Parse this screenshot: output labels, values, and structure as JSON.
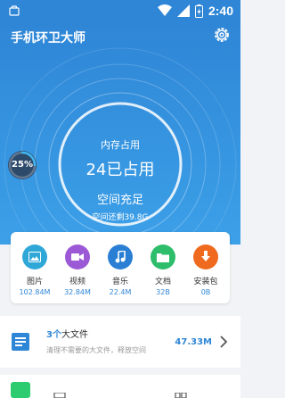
{
  "status_bar": {
    "time": "2:40"
  },
  "header": {
    "title": "手机环卫大师"
  },
  "memory": {
    "usage_percent_label": "25%",
    "usage_fraction": 0.25,
    "title": "内存占用",
    "value": "24已占用",
    "status": "空间充足",
    "free": "空间还剩39.8G"
  },
  "categories": [
    {
      "name": "图片",
      "size": "102.84M",
      "color": "#2fa8d8",
      "icon": "image-icon"
    },
    {
      "name": "视频",
      "size": "32.84M",
      "color": "#9b59d6",
      "icon": "video-icon"
    },
    {
      "name": "音乐",
      "size": "22.4M",
      "color": "#2a7fd4",
      "icon": "music-icon"
    },
    {
      "name": "文档",
      "size": "32B",
      "color": "#2ebd6b",
      "icon": "folder-icon"
    },
    {
      "name": "安装包",
      "size": "0B",
      "color": "#ef6a1f",
      "icon": "download-icon"
    }
  ],
  "large_files": {
    "count": "3个",
    "label": "大文件",
    "subtitle": "清理不需要的大文件，释放空间",
    "size": "47.33M"
  },
  "next_row": {
    "title": ""
  }
}
